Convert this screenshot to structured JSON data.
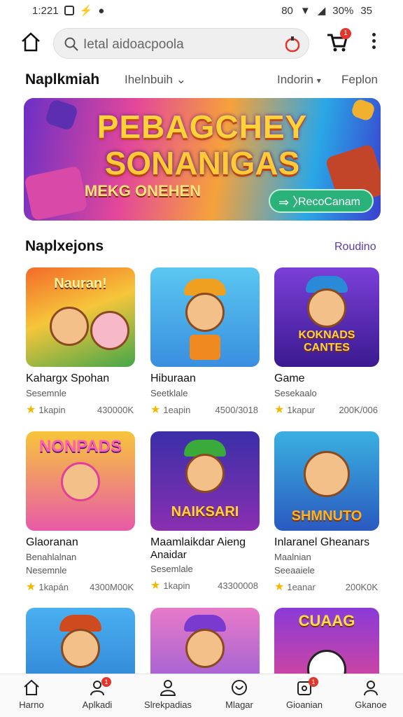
{
  "status": {
    "time": "1:221",
    "battery": "30%",
    "right_extra": "35",
    "left_digits": "80"
  },
  "search": {
    "placeholder": "Ietal aidoacpoola",
    "cart_badge": "1"
  },
  "nav": {
    "title": "Naplkmiah",
    "item1": "Ihelnbuih",
    "item2": "Indorin",
    "item3": "Feplon"
  },
  "banner": {
    "line1": "PEBAGCHEY",
    "line2": "SONANIGAS",
    "line3": "MEKG ONEHEN",
    "cta": "RecoCanam"
  },
  "section": {
    "title": "Naplxejons",
    "link": "Roudino"
  },
  "cards": [
    {
      "title": "Kahargx Spohan",
      "subtitle": "Sesemnle",
      "rating": "1kapin",
      "downloads": "430000K",
      "art_text": "Nauran!"
    },
    {
      "title": "Hiburaan",
      "subtitle": "Seetklale",
      "rating": "1eapin",
      "downloads": "4500/3018",
      "art_text": ""
    },
    {
      "title": "Game",
      "subtitle": "Sesekaalo",
      "rating": "1kapur",
      "downloads": "200K/006",
      "art_text": "KOKNADS CANTES"
    },
    {
      "title": "Glaoranan",
      "subtitle2": "Benahlalnan",
      "subtitle": "Nesemnle",
      "rating": "1kapán",
      "downloads": "4300M00K",
      "art_text": "NONPADS"
    },
    {
      "title": "Maamlaikdar Aieng",
      "subtitle2": "Anaidar",
      "subtitle": "Sesemlale",
      "rating": "1kapin",
      "downloads": "43300008",
      "art_text": "NAIKSARI"
    },
    {
      "title": "Inlaranel Gheanars",
      "subtitle2": "Maalnian",
      "subtitle": "Seeaaiele",
      "rating": "1eanar",
      "downloads": "200K0K",
      "art_text": "SHMNUTO"
    },
    {
      "title": "",
      "subtitle": "",
      "rating": "",
      "downloads": "",
      "art_text": ""
    },
    {
      "title": "",
      "subtitle": "",
      "rating": "",
      "downloads": "",
      "art_text": ""
    },
    {
      "title": "",
      "subtitle": "",
      "rating": "",
      "downloads": "",
      "art_text": "CUAAG"
    }
  ],
  "tabs": [
    {
      "label": "Harno",
      "badge": ""
    },
    {
      "label": "Aplkadi",
      "badge": "1"
    },
    {
      "label": "Slrekpadias",
      "badge": ""
    },
    {
      "label": "Mlagar",
      "badge": ""
    },
    {
      "label": "Gioanian",
      "badge": "1"
    },
    {
      "label": "Gkanoe",
      "badge": ""
    }
  ]
}
